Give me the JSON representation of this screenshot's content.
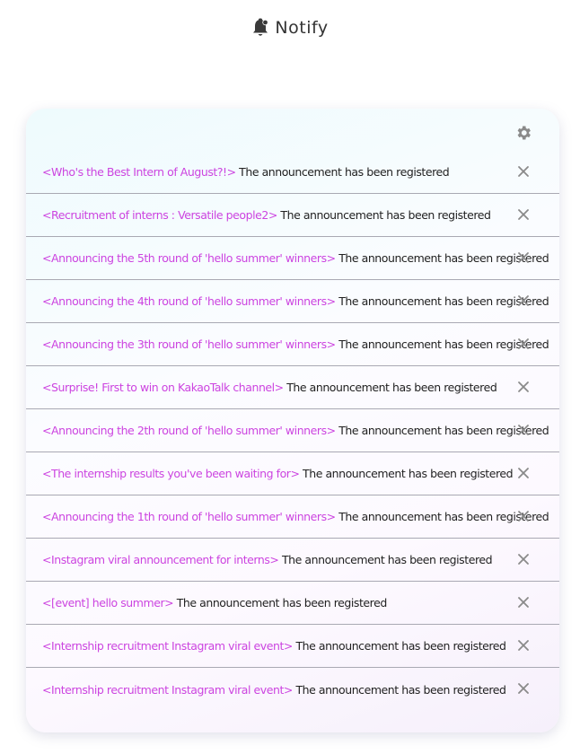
{
  "header": {
    "title": "Notify",
    "icon": "bell-icon"
  },
  "settings": {
    "icon": "gear-icon"
  },
  "notifications": [
    {
      "title": "<Who's the Best Intern of August?!>",
      "message": "The announcement has been registered"
    },
    {
      "title": "<Recruitment of interns : Versatile people2>",
      "message": "The announcement has been registered"
    },
    {
      "title": "<Announcing the 5th round of 'hello summer' winners>",
      "message": "The announcement has been registered"
    },
    {
      "title": "<Announcing the 4th round of 'hello summer' winners>",
      "message": "The announcement has been registered"
    },
    {
      "title": "<Announcing the 3th round of 'hello summer' winners>",
      "message": "The announcement has been registered"
    },
    {
      "title": "<Surprise! First to win on KakaoTalk channel>",
      "message": "The announcement has been registered"
    },
    {
      "title": "<Announcing the 2th round of 'hello summer' winners>",
      "message": "The announcement has been registered"
    },
    {
      "title": "<The internship results you've been waiting for>",
      "message": "The announcement has been registered"
    },
    {
      "title": "<Announcing the 1th round of 'hello summer' winners>",
      "message": "The announcement has been registered"
    },
    {
      "title": "<Instagram viral announcement for interns>",
      "message": "The announcement has been registered"
    },
    {
      "title": "<[event] hello summer>",
      "message": "The announcement has been registered"
    },
    {
      "title": "<Internship recruitment Instagram viral event>",
      "message": "The announcement has been registered"
    },
    {
      "title": "<Internship recruitment Instagram viral event>",
      "message": "The announcement has been registered"
    }
  ],
  "colors": {
    "title_link": "#cc44e0",
    "message": "#222222",
    "divider": "#a9a9b3",
    "icon": "#8a8a8a"
  }
}
